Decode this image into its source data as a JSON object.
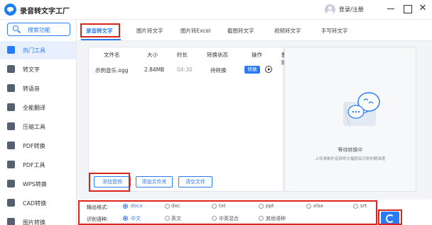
{
  "app": {
    "title": "录音转文字工厂",
    "login": "登录/注册"
  },
  "sidebar": {
    "search_label": "搜索功能",
    "items": [
      {
        "label": "热门工具"
      },
      {
        "label": "转文字"
      },
      {
        "label": "转语音"
      },
      {
        "label": "全能翻译"
      },
      {
        "label": "压缩工具"
      },
      {
        "label": "PDF转换"
      },
      {
        "label": "PDF工具"
      },
      {
        "label": "WPS转换"
      },
      {
        "label": "CAD转换"
      },
      {
        "label": "图片转换"
      }
    ]
  },
  "tabs": [
    {
      "label": "录音转文字"
    },
    {
      "label": "图片转文字"
    },
    {
      "label": "图片转Excel"
    },
    {
      "label": "截图转文字"
    },
    {
      "label": "视频转文字"
    },
    {
      "label": "手写转文字"
    }
  ],
  "table": {
    "headers": [
      "文件名",
      "大小",
      "时长",
      "转换状态",
      "操作",
      "删除"
    ],
    "rows": [
      {
        "name": "示例音乐.ogg",
        "size": "2.84MB",
        "duration": "04:30",
        "status": "待转换",
        "convert_label": "转换"
      }
    ]
  },
  "buttons": {
    "add_audio": "添加音频",
    "add_folder": "添加文件夹",
    "clear": "清空文件"
  },
  "waiting": {
    "title": "等待转换中",
    "subtitle": "上传清晰的音频将大幅提高识别的精准度"
  },
  "output": {
    "format_label": "输出格式:",
    "formats": [
      "docx",
      "doc",
      "txt",
      "ppt",
      "xlsx",
      "srt"
    ],
    "selected_format": "docx",
    "lang_label": "识别语种:",
    "languages": [
      "中文",
      "英文",
      "中英混合",
      "其他语种"
    ],
    "selected_language": "中文"
  },
  "colors": {
    "accent": "#2a7cf6",
    "highlight_box": "#d9251c"
  }
}
